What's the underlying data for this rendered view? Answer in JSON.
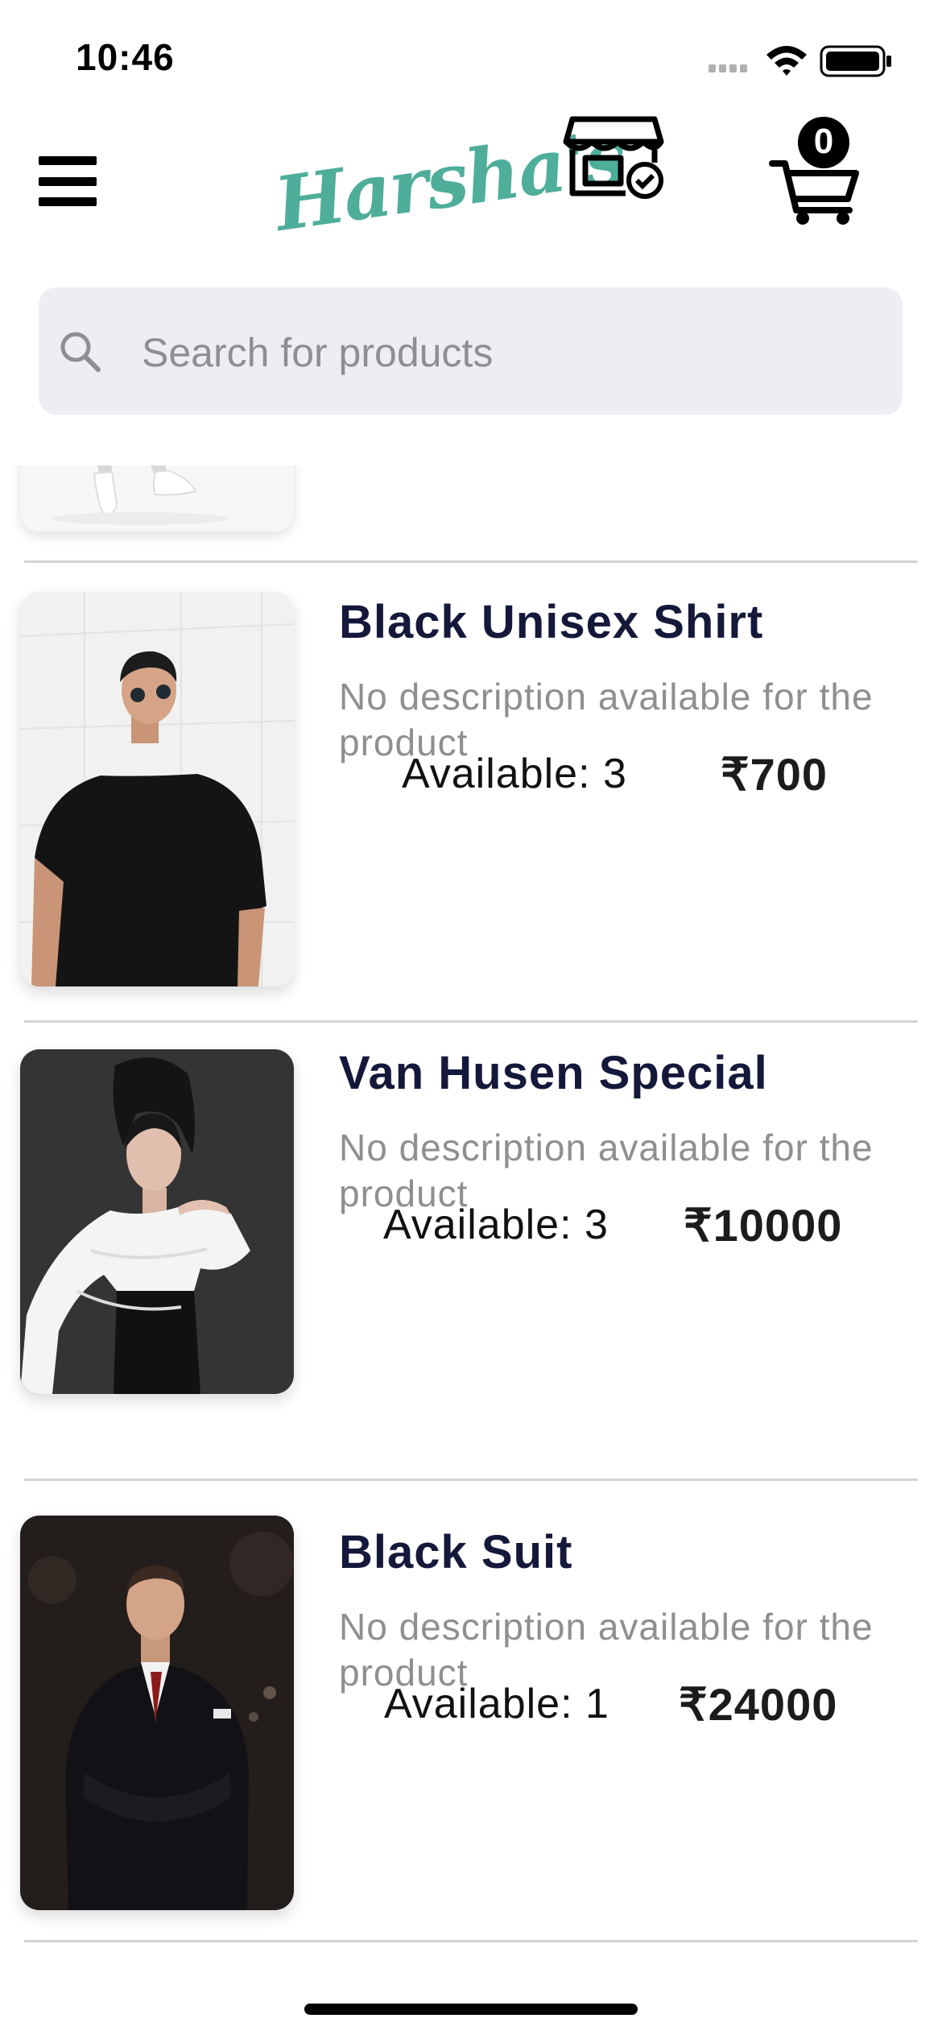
{
  "status_bar": {
    "time": "10:46"
  },
  "header": {
    "logo_text": "Harsha's",
    "cart_count": "0"
  },
  "search": {
    "placeholder": "Search for products"
  },
  "products": [
    {
      "title": "Black Unisex Shirt",
      "description": "No description available for the product",
      "available": "Available: 3",
      "price": "₹700"
    },
    {
      "title": "Van Husen Special",
      "description": "No description available for the product",
      "available": "Available: 3",
      "price": "₹10000"
    },
    {
      "title": "Black Suit",
      "description": "No description available for the product",
      "available": "Available: 1",
      "price": "₹24000"
    }
  ],
  "icons": {
    "menu": "hamburger-menu-icon",
    "store": "store-verified-icon",
    "cart": "shopping-cart-icon",
    "search": "search-icon"
  },
  "colors": {
    "brand": "#4eae9a",
    "title": "#14183a",
    "search_bg": "#eeeef2"
  }
}
